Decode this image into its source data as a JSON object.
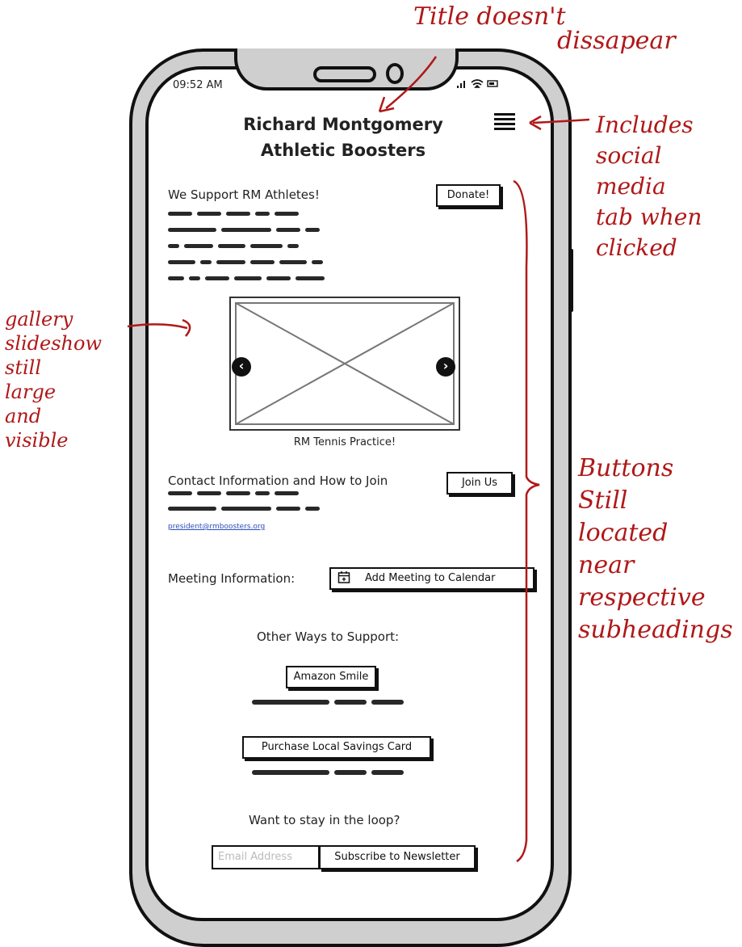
{
  "status_bar": {
    "time": "09:52 AM",
    "icons": "..ıl ≈ ▭"
  },
  "header": {
    "title_line1": "Richard Montgomery",
    "title_line2": "Athletic Boosters"
  },
  "support": {
    "heading": "We Support RM Athletes!",
    "donate_label": "Donate!"
  },
  "gallery": {
    "caption": "RM Tennis Practice!",
    "prev_glyph": "‹",
    "next_glyph": "›"
  },
  "contact": {
    "heading": "Contact Information and How to Join",
    "join_label": "Join Us",
    "email": "president@rmboosters.org"
  },
  "meeting": {
    "label": "Meeting Information:",
    "calendar_label": "Add Meeting to Calendar"
  },
  "other_ways": {
    "heading": "Other Ways to Support:",
    "amazon_label": "Amazon Smile",
    "savings_label": "Purchase Local Savings Card"
  },
  "newsletter": {
    "heading": "Want to stay in the loop?",
    "email_placeholder": "Email Address",
    "subscribe_label": "Subscribe to Newsletter"
  },
  "annotations": {
    "title_note_line1": "Title doesn't",
    "title_note_line2": "dissapear",
    "menu_note": "Includes\nsocial\nmedia\ntab when\nclicked",
    "gallery_note": "gallery\nslideshow\nstill\nlarge\nand\nvisible",
    "buttons_note": "Buttons\nStill\nlocated\nnear\nrespective\nsubheadings"
  },
  "colors": {
    "annotation": "#b01818",
    "link": "#2a4fb8",
    "frame": "#cfcfcf"
  }
}
